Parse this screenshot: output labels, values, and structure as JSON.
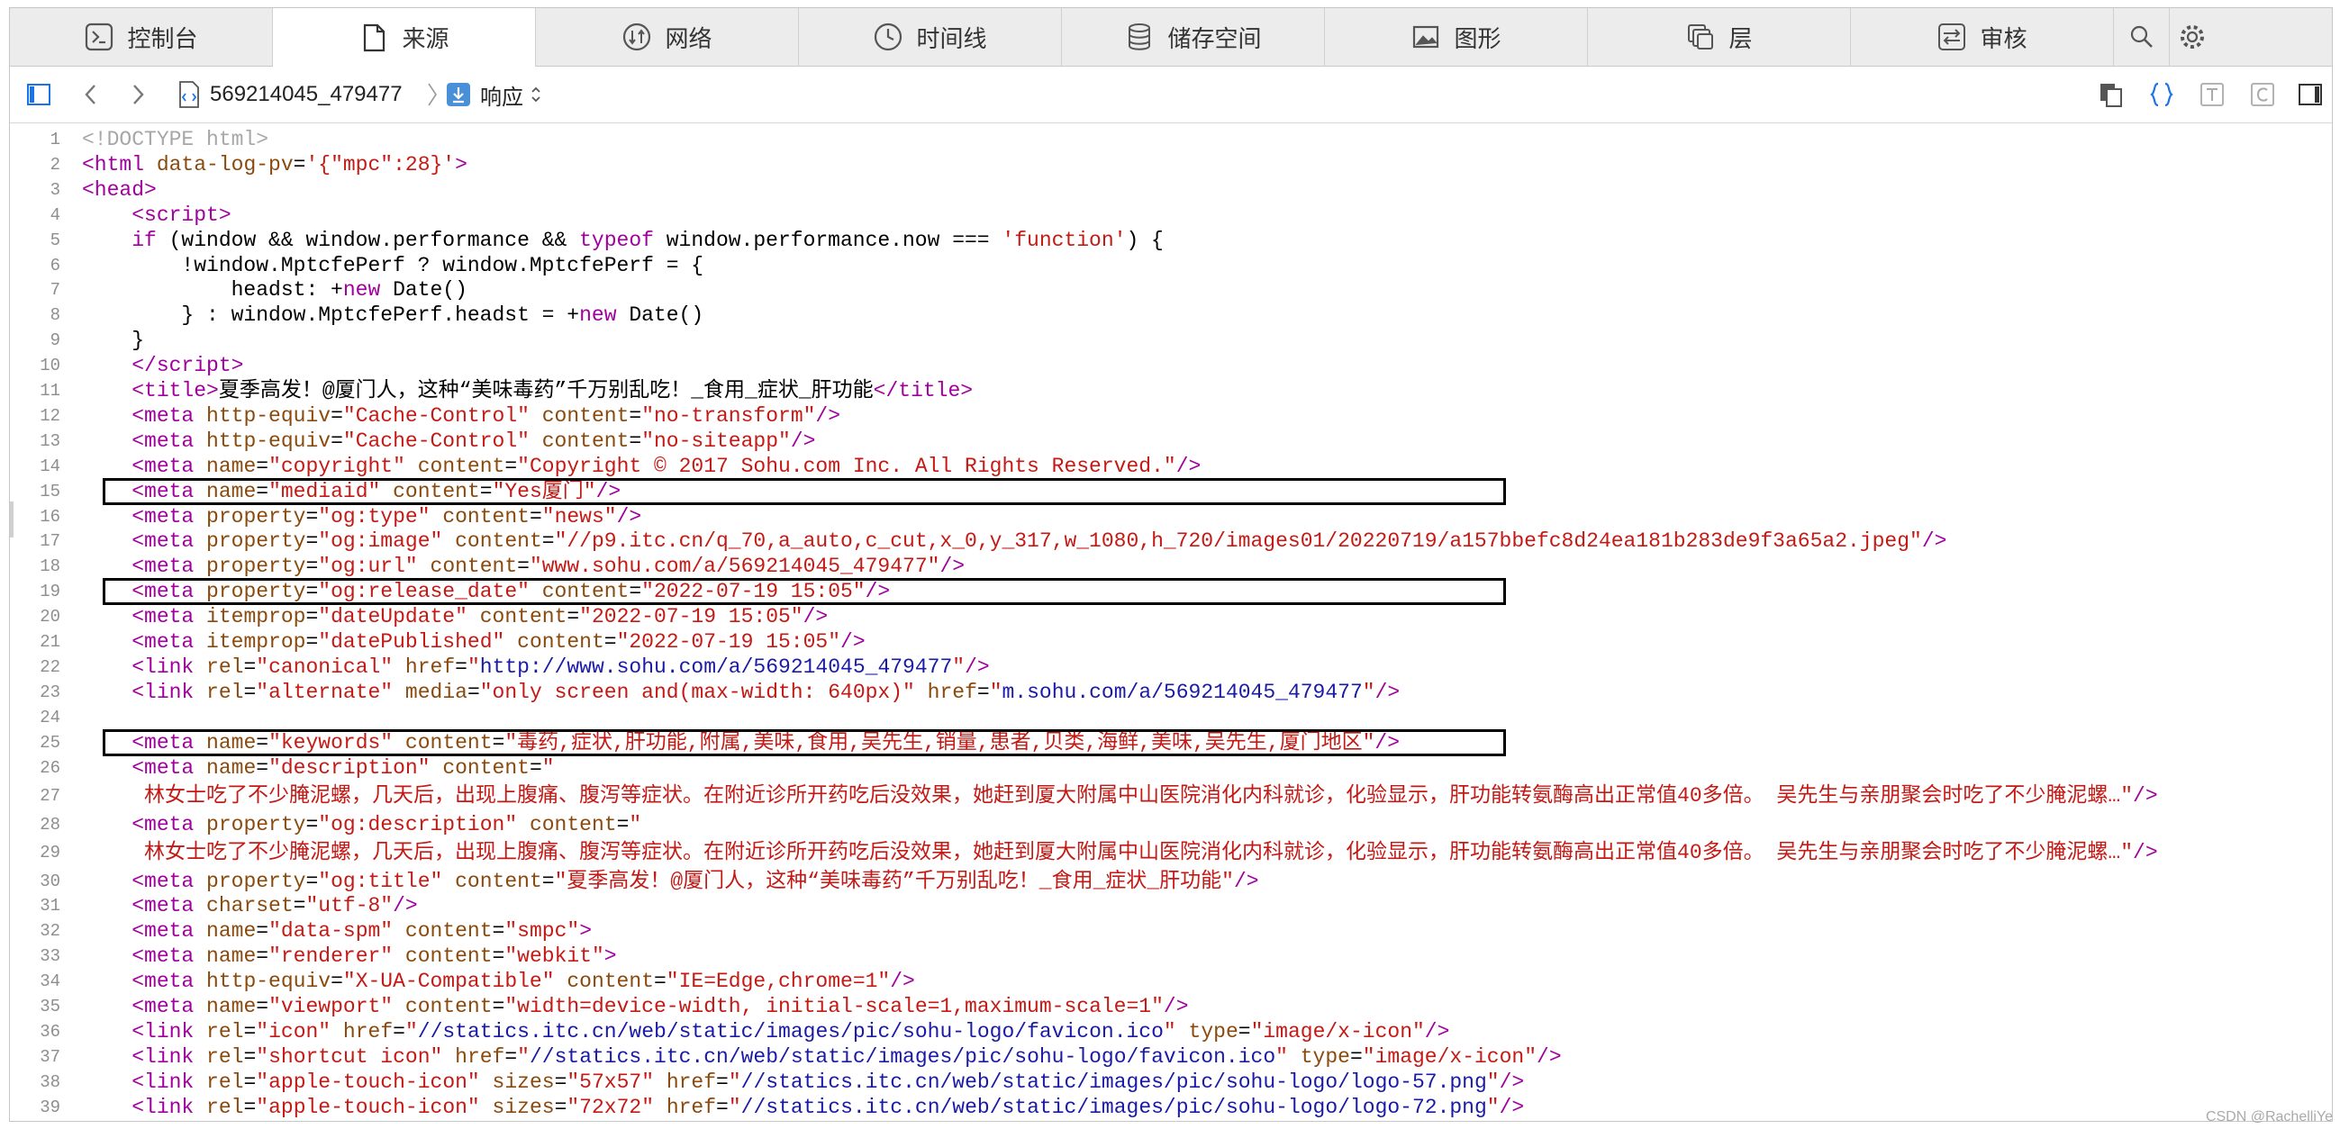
{
  "tabs": [
    {
      "label": "控制台",
      "icon": "console-icon"
    },
    {
      "label": "来源",
      "icon": "file-icon"
    },
    {
      "label": "网络",
      "icon": "network-icon"
    },
    {
      "label": "时间线",
      "icon": "clock-icon"
    },
    {
      "label": "储存空间",
      "icon": "database-icon"
    },
    {
      "label": "图形",
      "icon": "image-icon"
    },
    {
      "label": "层",
      "icon": "layers-icon"
    },
    {
      "label": "审核",
      "icon": "audit-icon"
    }
  ],
  "active_tab": "来源",
  "toolbar": {
    "resource_name": "569214045_479477",
    "response_label": "响应"
  },
  "code_lines": [
    {
      "n": "1",
      "html": "<span class=\"c\">&lt;!DOCTYPE html&gt;</span>"
    },
    {
      "n": "2",
      "html": "<span class=\"t\">&lt;html</span> <span class=\"a\">data-log-pv</span>=<span class=\"v\">'{\"mpc\":28}'</span><span class=\"t\">&gt;</span>"
    },
    {
      "n": "3",
      "html": "<span class=\"t\">&lt;head&gt;</span>"
    },
    {
      "n": "4",
      "html": "    <span class=\"t\">&lt;script&gt;</span>"
    },
    {
      "n": "5",
      "html": "    <span class=\"k\">if</span> (window &amp;&amp; window.performance &amp;&amp; <span class=\"k\">typeof</span> window.performance.now === <span class=\"v\">'function'</span>) {"
    },
    {
      "n": "6",
      "html": "        !window.MptcfePerf ? window.MptcfePerf = {"
    },
    {
      "n": "7",
      "html": "            headst: +<span class=\"k\">new</span> Date()"
    },
    {
      "n": "8",
      "html": "        } : window.MptcfePerf.headst = +<span class=\"k\">new</span> Date()"
    },
    {
      "n": "9",
      "html": "    }"
    },
    {
      "n": "10",
      "html": "    <span class=\"t\">&lt;/script&gt;</span>"
    },
    {
      "n": "11",
      "html": "    <span class=\"t\">&lt;title&gt;</span>夏季高发！@厦门人，这种“美味毒药”千万别乱吃！_食用_症状_肝功能<span class=\"t\">&lt;/title&gt;</span>"
    },
    {
      "n": "12",
      "html": "    <span class=\"t\">&lt;meta</span> <span class=\"a\">http-equiv</span>=<span class=\"v\">\"Cache-Control\"</span> <span class=\"a\">content</span>=<span class=\"v\">\"no-transform\"</span><span class=\"t\">/&gt;</span>"
    },
    {
      "n": "13",
      "html": "    <span class=\"t\">&lt;meta</span> <span class=\"a\">http-equiv</span>=<span class=\"v\">\"Cache-Control\"</span> <span class=\"a\">content</span>=<span class=\"v\">\"no-siteapp\"</span><span class=\"t\">/&gt;</span>"
    },
    {
      "n": "14",
      "html": "    <span class=\"t\">&lt;meta</span> <span class=\"a\">name</span>=<span class=\"v\">\"copyright\"</span> <span class=\"a\">content</span>=<span class=\"v\">\"Copyright © 2017 Sohu.com Inc. All Rights Reserved.\"</span><span class=\"t\">/&gt;</span>"
    },
    {
      "n": "15",
      "html": "    <span class=\"t\">&lt;meta</span> <span class=\"a\">name</span>=<span class=\"v\">\"mediaid\"</span> <span class=\"a\">content</span>=<span class=\"v\">\"Yes厦门\"</span><span class=\"t\">/&gt;</span>"
    },
    {
      "n": "16",
      "html": "    <span class=\"t\">&lt;meta</span> <span class=\"a\">property</span>=<span class=\"v\">\"og:type\"</span> <span class=\"a\">content</span>=<span class=\"v\">\"news\"</span><span class=\"t\">/&gt;</span>"
    },
    {
      "n": "17",
      "html": "    <span class=\"t\">&lt;meta</span> <span class=\"a\">property</span>=<span class=\"v\">\"og:image\"</span> <span class=\"a\">content</span>=<span class=\"v\">\"//p9.itc.cn/q_70,a_auto,c_cut,x_0,y_317,w_1080,h_720/images01/20220719/a157bbefc8d24ea181b283de9f3a65a2.jpeg\"</span><span class=\"t\">/&gt;</span>"
    },
    {
      "n": "18",
      "html": "    <span class=\"t\">&lt;meta</span> <span class=\"a\">property</span>=<span class=\"v\">\"og:url\"</span> <span class=\"a\">content</span>=<span class=\"v\">\"www.sohu.com/a/569214045_479477\"</span><span class=\"t\">/&gt;</span>"
    },
    {
      "n": "19",
      "html": "    <span class=\"t\">&lt;meta</span> <span class=\"a\">property</span>=<span class=\"v\">\"og:release_date\"</span> <span class=\"a\">content</span>=<span class=\"v\">\"2022-07-19 15:05\"</span><span class=\"t\">/&gt;</span>"
    },
    {
      "n": "20",
      "html": "    <span class=\"t\">&lt;meta</span> <span class=\"a\">itemprop</span>=<span class=\"v\">\"dateUpdate\"</span> <span class=\"a\">content</span>=<span class=\"v\">\"2022-07-19 15:05\"</span><span class=\"t\">/&gt;</span>"
    },
    {
      "n": "21",
      "html": "    <span class=\"t\">&lt;meta</span> <span class=\"a\">itemprop</span>=<span class=\"v\">\"datePublished\"</span> <span class=\"a\">content</span>=<span class=\"v\">\"2022-07-19 15:05\"</span><span class=\"t\">/&gt;</span>"
    },
    {
      "n": "22",
      "html": "    <span class=\"t\">&lt;link</span> <span class=\"a\">rel</span>=<span class=\"v\">\"canonical\"</span> <span class=\"a\">href</span>=<span class=\"v\">\"</span><span class=\"lnk\">http://www.sohu.com/a/569214045_479477</span><span class=\"v\">\"</span><span class=\"t\">/&gt;</span>"
    },
    {
      "n": "23",
      "html": "    <span class=\"t\">&lt;link</span> <span class=\"a\">rel</span>=<span class=\"v\">\"alternate\"</span> <span class=\"a\">media</span>=<span class=\"v\">\"only screen and(max-width: 640px)\"</span> <span class=\"a\">href</span>=<span class=\"v\">\"</span><span class=\"lnk\">m.sohu.com/a/569214045_479477</span><span class=\"v\">\"</span><span class=\"t\">/&gt;</span>"
    },
    {
      "n": "24",
      "html": ""
    },
    {
      "n": "25",
      "html": "    <span class=\"t\">&lt;meta</span> <span class=\"a\">name</span>=<span class=\"v\">\"keywords\"</span> <span class=\"a\">content</span>=<span class=\"v\">\"毒药,症状,肝功能,附属,美味,食用,吴先生,销量,患者,贝类,海鲜,美味,吴先生,厦门地区\"</span><span class=\"t\">/&gt;</span>"
    },
    {
      "n": "26",
      "html": "    <span class=\"t\">&lt;meta</span> <span class=\"a\">name</span>=<span class=\"v\">\"description\"</span> <span class=\"a\">content</span>=<span class=\"v\">\"</span>"
    },
    {
      "n": "27",
      "html": "     <span class=\"v\">林女士吃了不少腌泥螺，几天后，出现上腹痛、腹泻等症状。在附近诊所开药吃后没效果，她赶到厦大附属中山医院消化内科就诊，化验显示，肝功能转氨酶高出正常值40多倍。 吴先生与亲朋聚会时吃了不少腌泥螺…\"</span><span class=\"t\">/&gt;</span>"
    },
    {
      "n": "28",
      "html": "    <span class=\"t\">&lt;meta</span> <span class=\"a\">property</span>=<span class=\"v\">\"og:description\"</span> <span class=\"a\">content</span>=<span class=\"v\">\"</span>"
    },
    {
      "n": "29",
      "html": "     <span class=\"v\">林女士吃了不少腌泥螺，几天后，出现上腹痛、腹泻等症状。在附近诊所开药吃后没效果，她赶到厦大附属中山医院消化内科就诊，化验显示，肝功能转氨酶高出正常值40多倍。 吴先生与亲朋聚会时吃了不少腌泥螺…\"</span><span class=\"t\">/&gt;</span>"
    },
    {
      "n": "30",
      "html": "    <span class=\"t\">&lt;meta</span> <span class=\"a\">property</span>=<span class=\"v\">\"og:title\"</span> <span class=\"a\">content</span>=<span class=\"v\">\"夏季高发！@厦门人，这种“美味毒药”千万别乱吃！_食用_症状_肝功能\"</span><span class=\"t\">/&gt;</span>"
    },
    {
      "n": "31",
      "html": "    <span class=\"t\">&lt;meta</span> <span class=\"a\">charset</span>=<span class=\"v\">\"utf-8\"</span><span class=\"t\">/&gt;</span>"
    },
    {
      "n": "32",
      "html": "    <span class=\"t\">&lt;meta</span> <span class=\"a\">name</span>=<span class=\"v\">\"data-spm\"</span> <span class=\"a\">content</span>=<span class=\"v\">\"smpc\"</span><span class=\"t\">&gt;</span>"
    },
    {
      "n": "33",
      "html": "    <span class=\"t\">&lt;meta</span> <span class=\"a\">name</span>=<span class=\"v\">\"renderer\"</span> <span class=\"a\">content</span>=<span class=\"v\">\"webkit\"</span><span class=\"t\">&gt;</span>"
    },
    {
      "n": "34",
      "html": "    <span class=\"t\">&lt;meta</span> <span class=\"a\">http-equiv</span>=<span class=\"v\">\"X-UA-Compatible\"</span> <span class=\"a\">content</span>=<span class=\"v\">\"IE=Edge,chrome=1\"</span><span class=\"t\">/&gt;</span>"
    },
    {
      "n": "35",
      "html": "    <span class=\"t\">&lt;meta</span> <span class=\"a\">name</span>=<span class=\"v\">\"viewport\"</span> <span class=\"a\">content</span>=<span class=\"v\">\"width=device-width, initial-scale=1,maximum-scale=1\"</span><span class=\"t\">/&gt;</span>"
    },
    {
      "n": "36",
      "html": "    <span class=\"t\">&lt;link</span> <span class=\"a\">rel</span>=<span class=\"v\">\"icon\"</span> <span class=\"a\">href</span>=<span class=\"v\">\"</span><span class=\"lnk\">//statics.itc.cn/web/static/images/pic/sohu-logo/favicon.ico</span><span class=\"v\">\"</span> <span class=\"a\">type</span>=<span class=\"v\">\"image/x-icon\"</span><span class=\"t\">/&gt;</span>"
    },
    {
      "n": "37",
      "html": "    <span class=\"t\">&lt;link</span> <span class=\"a\">rel</span>=<span class=\"v\">\"shortcut icon\"</span> <span class=\"a\">href</span>=<span class=\"v\">\"</span><span class=\"lnk\">//statics.itc.cn/web/static/images/pic/sohu-logo/favicon.ico</span><span class=\"v\">\"</span> <span class=\"a\">type</span>=<span class=\"v\">\"image/x-icon\"</span><span class=\"t\">/&gt;</span>"
    },
    {
      "n": "38",
      "html": "    <span class=\"t\">&lt;link</span> <span class=\"a\">rel</span>=<span class=\"v\">\"apple-touch-icon\"</span> <span class=\"a\">sizes</span>=<span class=\"v\">\"57x57\"</span> <span class=\"a\">href</span>=<span class=\"v\">\"</span><span class=\"lnk\">//statics.itc.cn/web/static/images/pic/sohu-logo/logo-57.png</span><span class=\"v\">\"</span><span class=\"t\">/&gt;</span>"
    },
    {
      "n": "39",
      "html": "    <span class=\"t\">&lt;link</span> <span class=\"a\">rel</span>=<span class=\"v\">\"apple-touch-icon\"</span> <span class=\"a\">sizes</span>=<span class=\"v\">\"72x72\"</span> <span class=\"a\">href</span>=<span class=\"v\">\"</span><span class=\"lnk\">//statics.itc.cn/web/static/images/pic/sohu-logo/logo-72.png</span><span class=\"v\">\"</span><span class=\"t\">/&gt;</span>"
    }
  ],
  "highlighted_lines": [
    "15",
    "19",
    "25"
  ],
  "watermark": "CSDN @RachelliYe",
  "colors": {
    "tag": "#a1009e",
    "attr": "#8a4a0e",
    "value": "#c41a16",
    "link": "#1a1aa6",
    "accent": "#1a73e8"
  }
}
